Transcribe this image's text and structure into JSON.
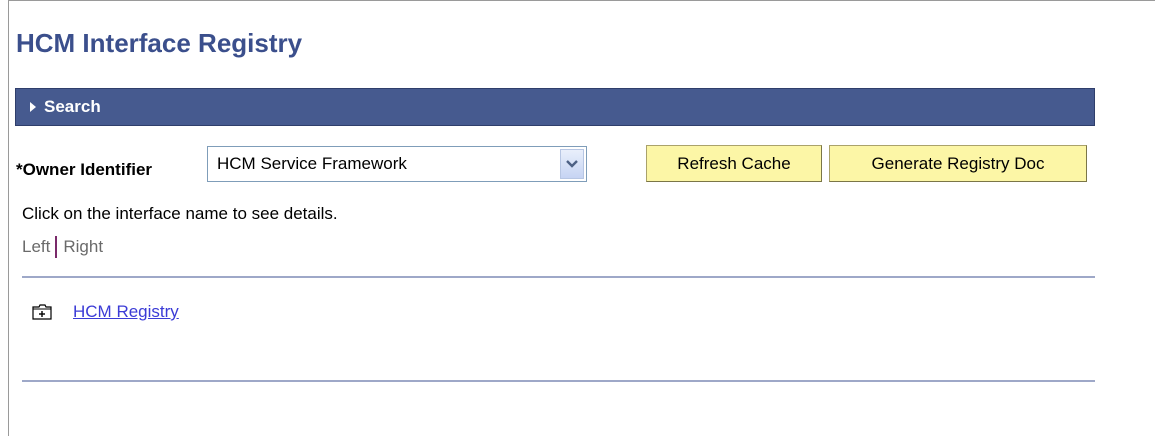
{
  "page": {
    "title": "HCM Interface Registry"
  },
  "search_section": {
    "label": "Search",
    "icon": "expand-triangle-icon"
  },
  "owner": {
    "label": "*Owner Identifier",
    "selected_value": "HCM Service Framework"
  },
  "buttons": {
    "refresh": "Refresh Cache",
    "generate": "Generate Registry Doc"
  },
  "instructions": "Click on the interface name to see details.",
  "layout_toggle": {
    "left": "Left",
    "right": "Right"
  },
  "tree": {
    "items": [
      {
        "label": "HCM Registry",
        "icon": "folder-expand-icon"
      }
    ]
  },
  "colors": {
    "title": "#3b4f8c",
    "search_bar": "#465a8f",
    "button_bg": "#fcf6a6",
    "link": "#3b3bd6",
    "divider": "#9ea8c8"
  }
}
